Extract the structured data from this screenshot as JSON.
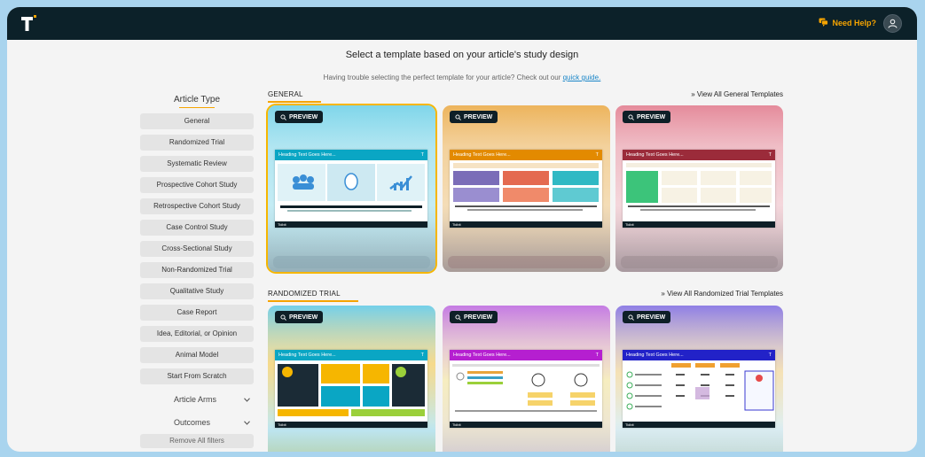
{
  "header": {
    "help_label": "Need Help?"
  },
  "page": {
    "title": "Select a template based on your article's study design",
    "subtitle_text": "Having trouble selecting the perfect template for your article? Check out our",
    "subtitle_link": "quick guide."
  },
  "sidebar": {
    "heading": "Article Type",
    "filters": [
      "General",
      "Randomized Trial",
      "Systematic Review",
      "Prospective Cohort Study",
      "Retrospective Cohort Study",
      "Case Control Study",
      "Cross-Sectional Study",
      "Non-Randomized Trial",
      "Qualitative Study",
      "Case Report",
      "Idea, Editorial, or Opinion",
      "Animal Model",
      "Start From Scratch"
    ],
    "article_arms": "Article Arms",
    "outcomes": "Outcomes",
    "remove_filters": "Remove All filters"
  },
  "sections": {
    "general": {
      "title": "GENERAL",
      "view_all": "View All General Templates"
    },
    "randomized": {
      "title": "RANDOMIZED TRIAL",
      "view_all": "View All Randomized Trial Templates"
    }
  },
  "preview_label": "PREVIEW",
  "thumb_heading": "Heading Text Goes Here...",
  "thumb_footer": "Tidbit",
  "colors": {
    "accent": "#f6a400",
    "topbar": "#0c2129",
    "card_cyan": "#7fd6ea",
    "card_orange": "#f0c27a",
    "card_rose": "#e9a1ad",
    "card_purple": "#c788e6",
    "card_violet": "#9d8be8"
  }
}
